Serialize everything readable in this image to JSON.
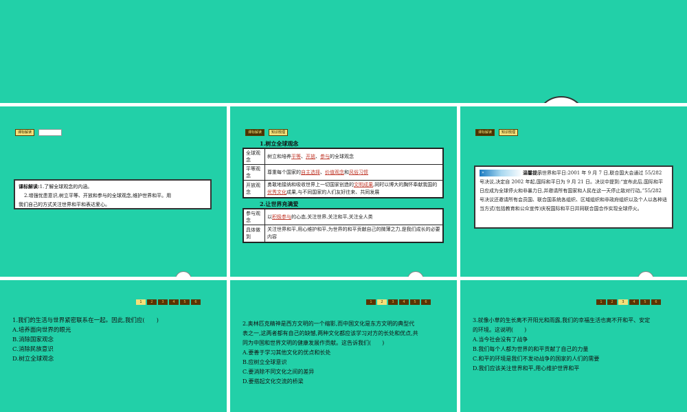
{
  "slide1": {
    "tag": "课标解读",
    "title": "课标解读:",
    "line1": "1.了解全球观念的内涵。",
    "line2": "2.增强忧患意识,树立平等、开放和参与的全球观念,维护世界和平。用",
    "line3": "我们自己的方式关注世界和平和表达爱心。"
  },
  "slide2": {
    "tag1": "课标解读",
    "tag2": "知识梳理",
    "sec1": "1.树立全球观念",
    "r1h": "全球观念",
    "r1a": "树立和培养",
    "r1b": "平等",
    "r1c": "、",
    "r1d": "开放",
    "r1e": "、",
    "r1f": "参与",
    "r1g": "的全球观念",
    "r2h": "平等观念",
    "r2a": "尊重每个国家的",
    "r2b": "自主选择",
    "r2c": "、",
    "r2d": "价值观念",
    "r2e": "和",
    "r2f": "风俗习惯",
    "r3h": "开放观念",
    "r3a": "勇敢地接纳和吸收世界上一切国家创造的",
    "r3b": "文明成果",
    "r3c": ",同时以博大的胸怀奉献我国的",
    "r3d": "优秀文化",
    "r3e": "成果,与不同国家的人们友好往来、共同发展",
    "sec2": "2.让世界充满爱",
    "s1h": "参与观念",
    "s1a": "以",
    "s1b": "积极参与",
    "s1c": "的心态,关注世界,关注和平,关注全人类",
    "s2h": "具体做到",
    "s2a": "关注世界和平,用心维护和平,为世界的和平贡献自己的微薄之力,是我们成长的必要内容"
  },
  "slide3": {
    "tag1": "课标解读",
    "tag2": "知识梳理",
    "banner": "温馨提示",
    "text": "世界和平日:2001 年 9 月 7 日,联合国大会通过 55/282 号决议,决定自 2002 年起,国际和平日为 9 月 21 日。决议中提到:“宣布此后,国际和平日应成为全球停火和非暴力日,并邀请所有国家和人民在这一天停止敌对行动。”55/282 号决议还邀请所有会员国、联合国系统各组织、区域组织和非政府组织以及个人以各种适当方式(包括教育和公众宣传)庆祝国际和平日并同联合国合作实现全球停火。"
  },
  "pager": [
    "1",
    "2",
    "3",
    "4",
    "5",
    "6"
  ],
  "q1": {
    "stem": "1.我们的生活与世界紧密联系在一起。因此,我们应(　　)",
    "a": "A.培养面向世界的眼光",
    "b": "B.消除国家观念",
    "c": "C.消除民族意识",
    "d": "D.树立全球观念"
  },
  "q2": {
    "stem1": "2.奥林匹克精神是西方文明的一个缩影,而中国文化是东方文明的典型代",
    "stem2": "表之一,这两者都有自己的缺憾,两种文化都应该学习对方的长处和优点,共",
    "stem3": "同为中国和世界文明的健康发展作贡献。这告诉我们(　　)",
    "a": "A.要善于学习其他文化的优点和长处",
    "b": "B.应树立全球意识",
    "c": "C.要消除不同文化之间的差异",
    "d": "D.要搭起文化交流的桥梁"
  },
  "q3": {
    "stem1": "3.就像小草的生长离不开阳光和雨露,我们的幸福生活也离不开和平、安定",
    "stem2": "的环境。这说明(　　)",
    "a": "A.当今社会没有了战争",
    "b": "B.我们每个人都为世界的和平贡献了自己的力量",
    "c": "C.和平的环境是我们不发动战争的国家的人们的需要",
    "d": "D.我们应该关注世界和平,用心维护世界和平"
  }
}
